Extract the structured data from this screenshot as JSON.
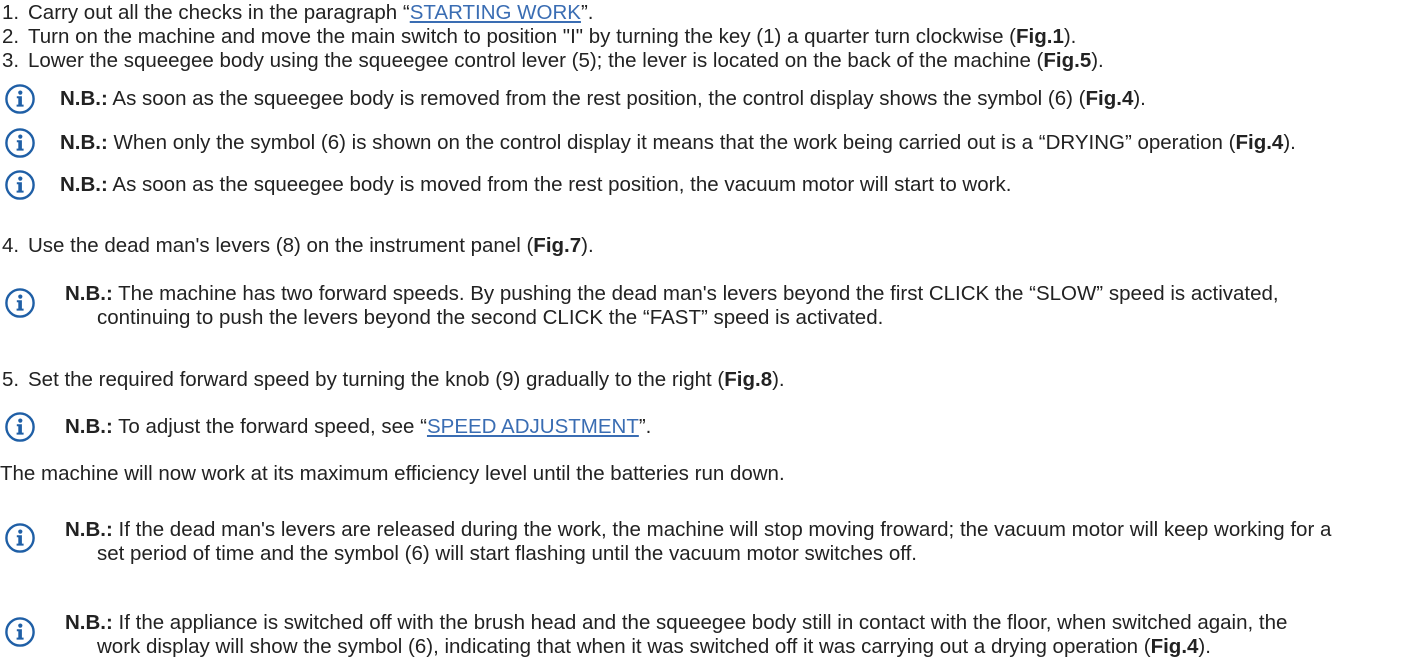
{
  "steps": [
    {
      "number": "1.",
      "text": "Carry out all the checks in the paragraph “",
      "link": "STARTING WORK",
      "tail": "”."
    },
    {
      "number": "2.",
      "text": "Turn on the machine and move the main switch to position \"I\" by turning the key (1) a quarter turn clockwise (",
      "fig": "Fig.1",
      "tail": ")."
    },
    {
      "number": "3.",
      "text": "Lower the squeegee body using the squeegee control lever (5); the lever is located on the back of the machine (",
      "fig": "Fig.5",
      "tail": ")."
    },
    {
      "number": "4.",
      "text": "Use the dead man's levers (8) on the instrument panel (",
      "fig": "Fig.7",
      "tail": ")."
    },
    {
      "number": "5.",
      "text": "Set the required forward speed by turning the knob (9) gradually to the right (",
      "fig": "Fig.8",
      "tail": ")."
    }
  ],
  "notes": [
    {
      "label": "N.B.:",
      "text": "As soon as the squeegee body is removed from the rest position, the control display shows the symbol (6) (",
      "fig": "Fig.4",
      "tail": ")."
    },
    {
      "label": "N.B.:",
      "text": "When only the symbol (6) is shown on the control display it means that the work being carried out is a “DRYING” operation (",
      "fig": "Fig.4",
      "tail": ")."
    },
    {
      "label": "N.B.:",
      "text": "As soon as the squeegee body is moved from the rest position, the vacuum motor will start to work."
    },
    {
      "label": "N.B.:",
      "line1": "The machine has two forward speeds. By pushing the dead man's levers beyond the first CLICK the “SLOW” speed is activated,",
      "line2": "continuing to push the levers beyond the second CLICK the “FAST” speed is activated."
    },
    {
      "label": "N.B.:",
      "text": "To adjust the forward speed, see “",
      "link": "SPEED ADJUSTMENT",
      "tail": "”."
    },
    {
      "label": "N.B.:",
      "line1": "If the dead man's levers are released during the work, the machine will stop moving froward; the vacuum motor will keep working for a",
      "line2": "set period of time and the symbol (6) will start flashing until the vacuum motor switches off."
    },
    {
      "label": "N.B.:",
      "line1": "If the appliance is switched off with the brush head and the squeegee body still in contact with the floor, when switched again, the",
      "line2": "work display will show the symbol (6), indicating that when it was switched off it was carrying out a drying operation (",
      "fig": "Fig.4",
      "tail": ")."
    }
  ],
  "paragraph": "The machine will now work at its maximum efficiency level until the batteries run down.",
  "icon": "info-icon",
  "colors": {
    "text": "#222222",
    "link": "#3a6db3",
    "icon": "#1f5fa6"
  }
}
